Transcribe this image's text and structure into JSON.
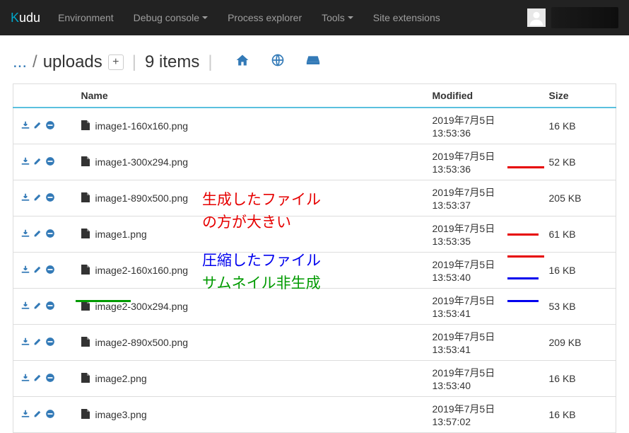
{
  "brand": {
    "prefix": "K",
    "rest": "udu"
  },
  "nav": {
    "environment": "Environment",
    "debug_console": "Debug console",
    "process_explorer": "Process explorer",
    "tools": "Tools",
    "site_extensions": "Site extensions"
  },
  "breadcrumb": {
    "ellipsis": "...",
    "segment": "uploads",
    "add": "+"
  },
  "item_count": "9 items",
  "table": {
    "headers": {
      "name": "Name",
      "modified": "Modified",
      "size": "Size"
    },
    "rows": [
      {
        "name": "image1-160x160.png",
        "modified": "2019年7月5日 13:53:36",
        "size": "16 KB"
      },
      {
        "name": "image1-300x294.png",
        "modified": "2019年7月5日 13:53:36",
        "size": "52 KB"
      },
      {
        "name": "image1-890x500.png",
        "modified": "2019年7月5日 13:53:37",
        "size": "205 KB"
      },
      {
        "name": "image1.png",
        "modified": "2019年7月5日 13:53:35",
        "size": "61 KB"
      },
      {
        "name": "image2-160x160.png",
        "modified": "2019年7月5日 13:53:40",
        "size": "16 KB"
      },
      {
        "name": "image2-300x294.png",
        "modified": "2019年7月5日 13:53:41",
        "size": "53 KB"
      },
      {
        "name": "image2-890x500.png",
        "modified": "2019年7月5日 13:53:41",
        "size": "209 KB"
      },
      {
        "name": "image2.png",
        "modified": "2019年7月5日 13:53:40",
        "size": "16 KB"
      },
      {
        "name": "image3.png",
        "modified": "2019年7月5日 13:57:02",
        "size": "16 KB"
      }
    ]
  },
  "annotations": {
    "line1": "生成したファイル",
    "line2": "の方が大きい",
    "line3": "圧縮したファイル",
    "line4": "サムネイル非生成"
  }
}
